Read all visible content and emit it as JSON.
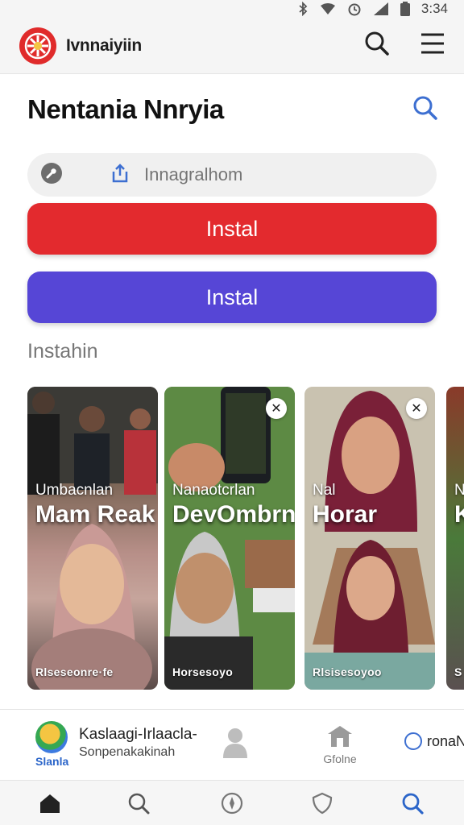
{
  "status_bar": {
    "time": "3:34",
    "icons": [
      "bluetooth-icon",
      "wifi-icon",
      "alarm-icon",
      "signal-icon",
      "battery-icon"
    ]
  },
  "app_bar": {
    "app_name": "Ivnnaiyiin",
    "icons": [
      "logo-icon",
      "search-icon",
      "menu-icon"
    ]
  },
  "page": {
    "title": "Nentania Nnryia"
  },
  "search": {
    "placeholder": "Innagralhom"
  },
  "buttons": {
    "primary_label": "Instal",
    "secondary_label": "Instal"
  },
  "section": {
    "label": "Instahin"
  },
  "cards": [
    {
      "title": "Umbacnlan",
      "subtitle": "Mam Reak",
      "footer": "Rlseseonre·fe"
    },
    {
      "title": "Nanaotcrlan",
      "subtitle": "DevOmbrn",
      "footer": "Horsesoyo"
    },
    {
      "title": "Nal",
      "subtitle": "Horar",
      "footer": "Rlsisesoyoo"
    },
    {
      "title": "N",
      "subtitle": "K",
      "footer": "S"
    }
  ],
  "suggestion": {
    "contact_label": "Slanla",
    "name": "Kaslaagi-Irlaacla-",
    "detail": "Sonpenakakinah",
    "middle_label": "Gfolne",
    "right_label": "ronaN"
  },
  "colors": {
    "primary_red": "#e32a2e",
    "secondary_purple": "#5646d6",
    "accent_blue": "#3d7be0"
  }
}
